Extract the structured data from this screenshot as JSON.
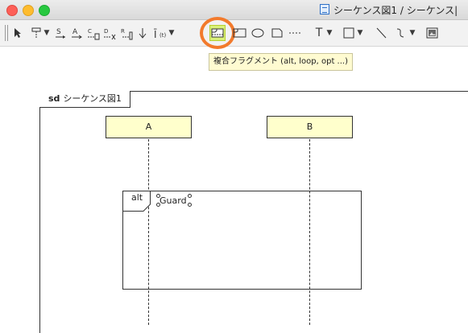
{
  "window": {
    "title": "シーケンス図1 / シーケンス|"
  },
  "toolbar": {
    "tooltip": "複合フラグメント (alt, loop, opt ...)",
    "tools": [
      "select-pointer-icon",
      "lifeline-icon",
      "sync-message-icon",
      "async-message-icon",
      "reply-message-icon",
      "create-message-icon",
      "destroy-message-icon",
      "found-message-icon",
      "lost-message-icon",
      "state-invariant-icon",
      "combined-fragment-icon",
      "interaction-use-icon",
      "note-ellipse-icon",
      "note-icon",
      "anchor-line-icon",
      "text-icon",
      "rectangle-icon",
      "line-icon",
      "freehand-line-icon",
      "image-icon"
    ],
    "highlight_color": "#f27a2c"
  },
  "diagram": {
    "frame_keyword": "sd",
    "frame_name": "シーケンス図1",
    "lifelines": [
      {
        "name": "A"
      },
      {
        "name": "B"
      }
    ],
    "fragment": {
      "operator": "alt",
      "guard": "Guard"
    },
    "lifeline_fill": "#ffffcc"
  }
}
